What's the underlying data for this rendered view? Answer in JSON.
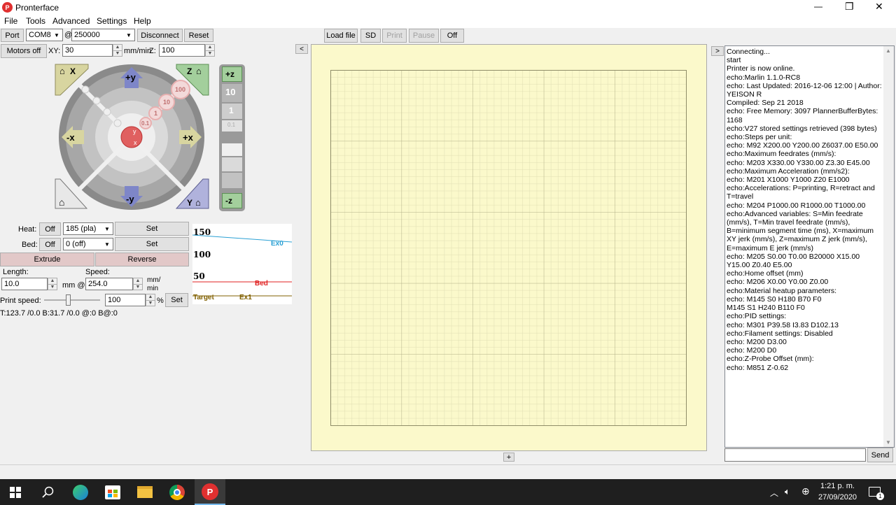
{
  "window": {
    "title": "Pronterface",
    "min": "—",
    "max": "❐",
    "close": "✕",
    "app_icon": "P"
  },
  "menu": [
    "File",
    "Tools",
    "Advanced",
    "Settings",
    "Help"
  ],
  "connection": {
    "port_label": "Port",
    "port_value": "COM8",
    "at": "@",
    "baud_value": "250000",
    "disconnect_label": "Disconnect",
    "reset_label": "Reset"
  },
  "motors": {
    "motors_off_label": "Motors off",
    "xy_label": "XY:",
    "xy_value": "30",
    "unit_label": "mm/min",
    "z_label": "Z:",
    "z_value": "100"
  },
  "jog": {
    "home_x": "X",
    "home_z": "Z",
    "home_y": "Y",
    "plus_y": "+y",
    "minus_y": "-y",
    "plus_x": "+x",
    "minus_x": "-x",
    "step_100": "100",
    "step_10": "10",
    "step_1": "1",
    "step_01": "0.1",
    "z_plus": "+z",
    "z_minus": "-z",
    "z_10": "10",
    "z_1": "1",
    "z_01": "0.1",
    "center_y": "y",
    "center_x": "x"
  },
  "temps": {
    "heat_label": "Heat:",
    "heat_off": "Off",
    "heat_value": "185 (pla)",
    "heat_set": "Set",
    "bed_label": "Bed:",
    "bed_off": "Off",
    "bed_value": "0 (off)",
    "bed_set": "Set"
  },
  "extrude": {
    "extrude_label": "Extrude",
    "reverse_label": "Reverse",
    "length_label": "Length:",
    "speed_label": "Speed:",
    "length_value": "10.0",
    "mm_at": "mm @",
    "speed_value": "254.0",
    "speed_unit_1": "mm/",
    "speed_unit_2": "min"
  },
  "print_speed": {
    "label": "Print speed:",
    "value": "100",
    "percent": "%",
    "set_label": "Set",
    "slider_level": 0.42
  },
  "status_line": "T:123.7 /0.0 B:31.7 /0.0 @:0 B@:0",
  "temp_graph": {
    "y_labels": [
      "150",
      "100",
      "50"
    ],
    "ex0_label": "Ex0",
    "bed_label": "Bed",
    "target_label": "Target",
    "ex1_label": "Ex1",
    "colors": {
      "ex0": "#2aa0d4",
      "bed": "#e02020",
      "target": "#806000",
      "ex1": "#806000"
    }
  },
  "print_controls": {
    "collapse_left": "<",
    "load_file": "Load file",
    "sd": "SD",
    "print": "Print",
    "pause": "Pause",
    "off": "Off",
    "plus": "+",
    "collapse_right": ">"
  },
  "console": {
    "lines": [
      "Connecting...",
      "start",
      "Printer is now online.",
      "echo:Marlin 1.1.0-RC8",
      "echo: Last Updated: 2016-12-06 12:00 | Author: YEISON R",
      "Compiled: Sep 21 2018",
      "echo: Free Memory: 3097  PlannerBufferBytes: 1168",
      "echo:V27 stored settings retrieved (398 bytes)",
      "echo:Steps per unit:",
      "echo:  M92 X200.00 Y200.00 Z6037.00 E50.00",
      "echo:Maximum feedrates (mm/s):",
      "echo:  M203 X330.00 Y330.00 Z3.30 E45.00",
      "echo:Maximum Acceleration (mm/s2):",
      "echo:  M201 X1000 Y1000 Z20 E1000",
      "echo:Accelerations: P=printing, R=retract and T=travel",
      "echo:  M204 P1000.00 R1000.00 T1000.00",
      "echo:Advanced variables: S=Min feedrate (mm/s), T=Min travel feedrate (mm/s), B=minimum segment time (ms), X=maximum XY jerk (mm/s),  Z=maximum Z jerk (mm/s), E=maximum E jerk (mm/s)",
      "echo:  M205 S0.00 T0.00 B20000 X15.00 Y15.00 Z0.40 E5.00",
      "echo:Home offset (mm)",
      "echo:  M206 X0.00 Y0.00 Z0.00",
      "echo:Material heatup parameters:",
      "echo:  M145 S0 H180 B70 F0",
      "  M145 S1 H240 B110 F0",
      "echo:PID settings:",
      "echo:  M301 P39.58 I3.83 D102.13",
      "echo:Filament settings: Disabled",
      "echo:  M200 D3.00",
      "echo:  M200 D0",
      "echo:Z-Probe Offset (mm):",
      "echo:  M851 Z-0.62"
    ],
    "input_value": "",
    "send_label": "Send"
  },
  "taskbar": {
    "time": "1:21 p. m.",
    "date": "27/09/2020",
    "notif_count": "1"
  }
}
